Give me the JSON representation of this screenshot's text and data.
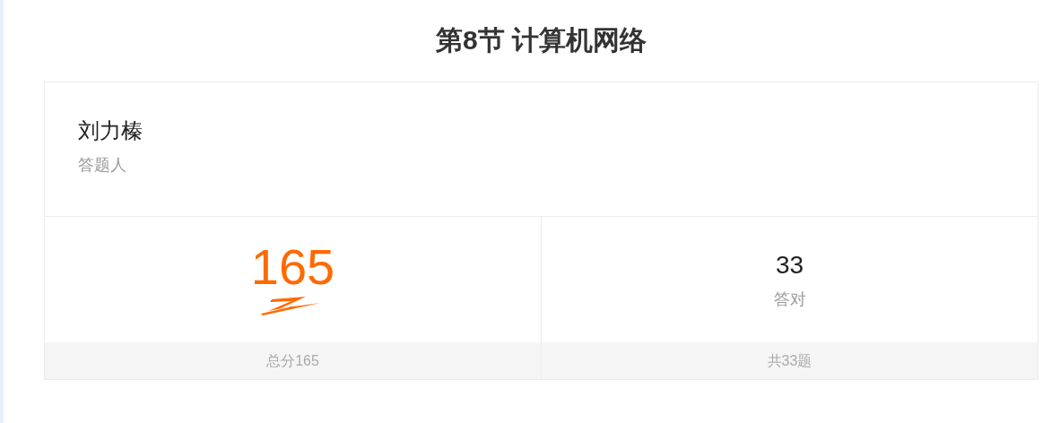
{
  "title": "第8节 计算机网络",
  "respondent": {
    "name": "刘力榛",
    "label": "答题人"
  },
  "stats": [
    {
      "kind": "score",
      "value": "165",
      "footer": "总分165"
    },
    {
      "kind": "count",
      "value": "33",
      "label": "答对",
      "footer": "共33题"
    }
  ]
}
